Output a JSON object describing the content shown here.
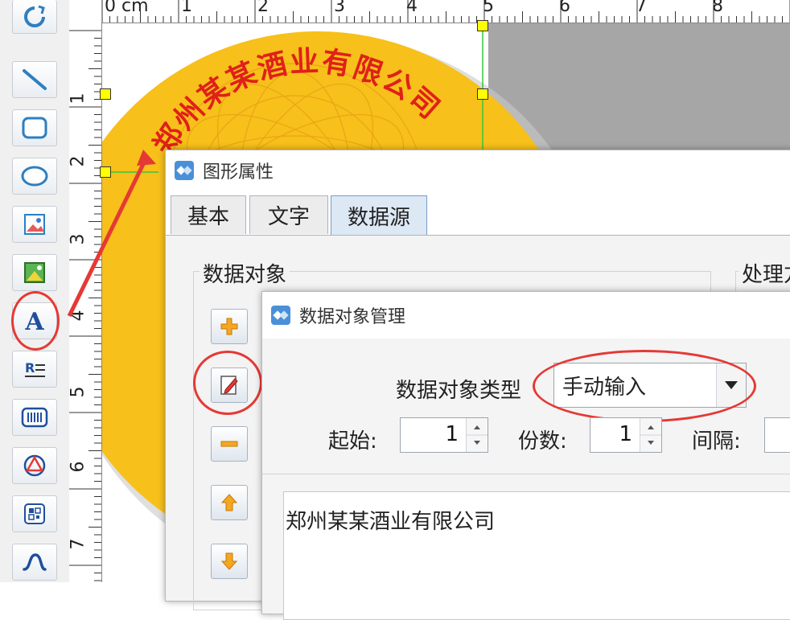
{
  "ruler": {
    "top_labels": [
      "0 cm",
      "1",
      "2",
      "3",
      "4",
      "5",
      "6",
      "7",
      "8"
    ],
    "left_labels": [
      "1",
      "2",
      "3",
      "4",
      "5",
      "6",
      "7"
    ]
  },
  "toolbar": {
    "items": [
      {
        "name": "rotate-icon"
      },
      {
        "name": "line-icon"
      },
      {
        "name": "rounded-rectangle-icon"
      },
      {
        "name": "ellipse-icon"
      },
      {
        "name": "image-icon"
      },
      {
        "name": "picture-icon"
      },
      {
        "name": "text-icon",
        "glyph": "A"
      },
      {
        "name": "rich-text-icon"
      },
      {
        "name": "barcode-icon"
      },
      {
        "name": "shape-icon"
      },
      {
        "name": "qrcode-icon"
      },
      {
        "name": "curve-icon"
      }
    ]
  },
  "seal": {
    "text": "郑州某某酒业有限公司",
    "color": "#e0201a",
    "fill": "#f7c01a"
  },
  "properties_dialog": {
    "title": "图形属性",
    "tabs": [
      "基本",
      "文字",
      "数据源"
    ],
    "active_tab": "数据源",
    "group_label": "数据对象",
    "right_group_label": "处理方"
  },
  "data_object_dialog": {
    "title": "数据对象管理",
    "type_label": "数据对象类型",
    "type_value": "手动输入",
    "start_label": "起始:",
    "start_value": "1",
    "copies_label": "份数:",
    "copies_value": "1",
    "interval_label": "间隔:",
    "content": "郑州某某酒业有限公司"
  },
  "colors": {
    "highlight_red": "#e53935",
    "canvas_gray": "#a6a6a6"
  }
}
